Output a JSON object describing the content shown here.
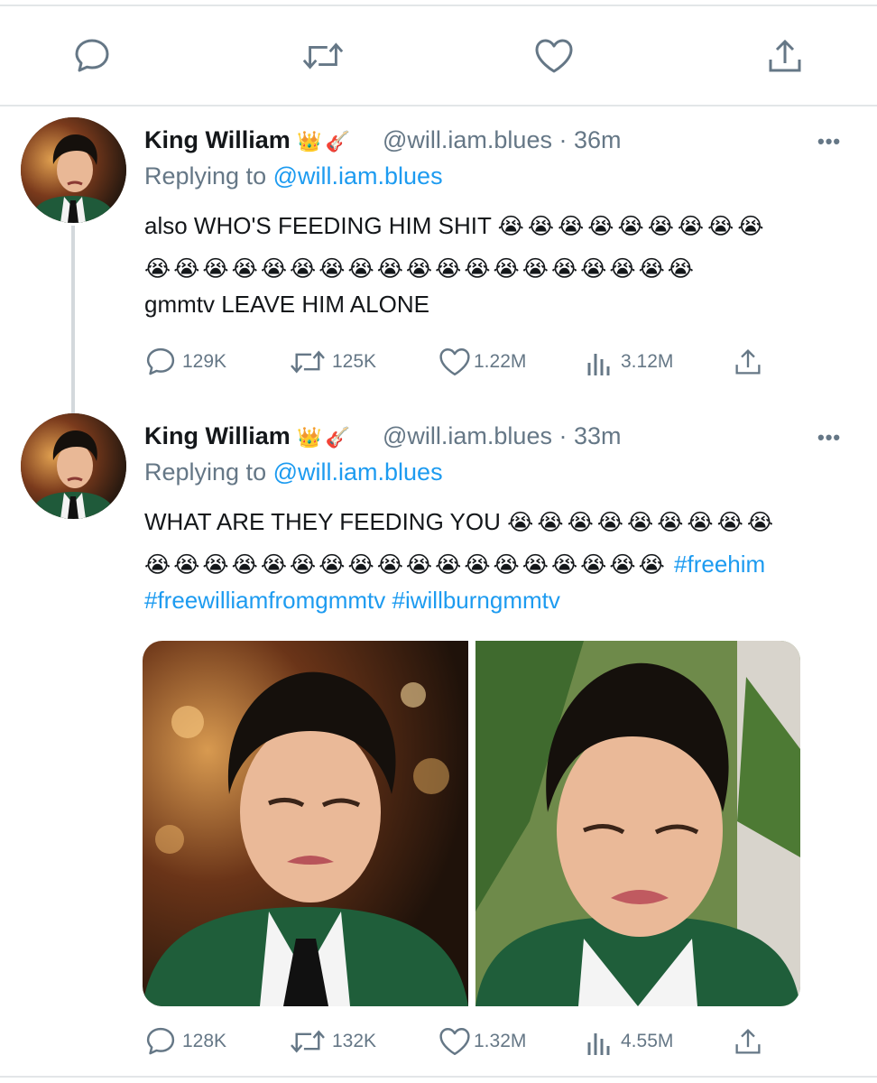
{
  "top_actions": {
    "icons": [
      "reply-icon",
      "retweet-icon",
      "like-icon",
      "share-icon"
    ]
  },
  "tweets": [
    {
      "display_name": "King William",
      "name_emojis": "👑🎸",
      "handle": "@will.iam.blues",
      "separator": "·",
      "time": "36m",
      "replying_prefix": "Replying to",
      "replying_to": "@will.iam.blues",
      "line1_text": "also WHO'S FEEDING HIM SHIT",
      "line1_emojis": "😭😭😭😭😭😭😭😭😭",
      "line2_emojis": "😭😭😭😭😭😭😭😭😭😭😭😭😭😭😭😭😭😭😭",
      "line3_text": "gmmtv LEAVE HIM ALONE",
      "more": "•••",
      "stats": {
        "replies": "129K",
        "retweets": "125K",
        "likes": "1.22M",
        "views": "3.12M"
      }
    },
    {
      "display_name": "King William",
      "name_emojis": "👑🎸",
      "handle": "@will.iam.blues",
      "separator": "·",
      "time": "33m",
      "replying_prefix": "Replying to",
      "replying_to": "@will.iam.blues",
      "line1_text": "WHAT ARE THEY FEEDING YOU",
      "line1_emojis": "😭😭😭😭😭😭😭😭😭",
      "line2_emojis": "😭😭😭😭😭😭😭😭😭😭😭😭😭😭😭😭😭😭",
      "hashtag1": "#freehim",
      "hashtag2": "#freewilliamfromgmmtv",
      "hashtag3": "#iwillburngmmtv",
      "more": "•••",
      "stats": {
        "replies": "128K",
        "retweets": "132K",
        "likes": "1.32M",
        "views": "4.55M"
      }
    }
  ],
  "colors": {
    "accent": "#1d9bf0",
    "muted": "#657786",
    "text": "#14171a",
    "divider": "#e3e6e8"
  }
}
